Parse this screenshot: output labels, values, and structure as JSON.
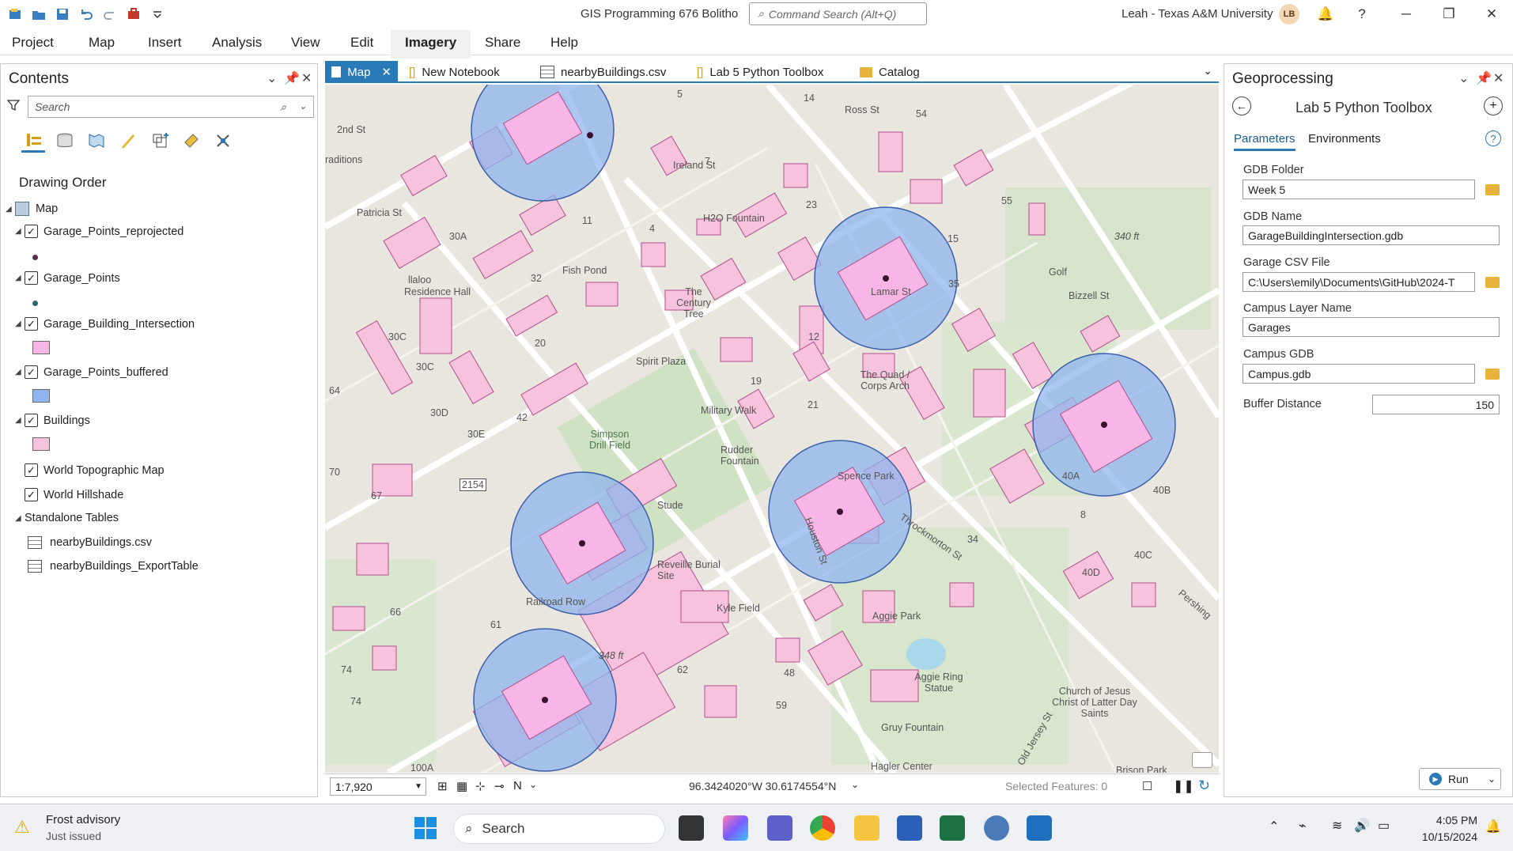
{
  "app": {
    "title": "GIS Programming 676 Bolitho",
    "command_search_placeholder": "Command Search (Alt+Q)",
    "user": "Leah - Texas A&M University",
    "avatar_initials": "LB"
  },
  "menu": [
    "Project",
    "Map",
    "Insert",
    "Analysis",
    "View",
    "Edit",
    "Imagery",
    "Share",
    "Help"
  ],
  "contents": {
    "title": "Contents",
    "search_placeholder": "Search",
    "drawing_order": "Drawing Order",
    "map_label": "Map",
    "layers": [
      {
        "name": "Garage_Points_reprojected",
        "symbol_color": "#5a2a4a"
      },
      {
        "name": "Garage_Points",
        "symbol_color": "#2c6a6a"
      },
      {
        "name": "Garage_Building_Intersection",
        "symbol_color": "#f7b6e6"
      },
      {
        "name": "Garage_Points_buffered",
        "symbol_color": "#8fb4ee"
      },
      {
        "name": "Buildings",
        "symbol_color": "#f7c2dc"
      },
      {
        "name": "World Topographic Map"
      },
      {
        "name": "World Hillshade"
      }
    ],
    "standalone_tables_label": "Standalone Tables",
    "tables": [
      "nearbyBuildings.csv",
      "nearbyBuildings_ExportTable"
    ]
  },
  "map_tabs": [
    "Map",
    "New Notebook",
    "nearbyBuildings.csv",
    "Lab 5 Python Toolbox",
    "Catalog"
  ],
  "map": {
    "labels": [
      "5",
      "14",
      "54",
      "Ross St",
      "raditions",
      "2nd St",
      "7",
      "Ireland St",
      "H2O Fountain",
      "23",
      "15",
      "55",
      "Patricia St",
      "30A",
      "11",
      "4",
      "340 ft",
      "Golf",
      "32",
      "Fish Pond",
      "llaloo",
      "Residence Hall",
      "The Century Tree",
      "Lamar St",
      "35",
      "Bizzell St",
      "30C",
      "20",
      "Spirit Plaza",
      "12",
      "30C",
      "The Quad / Corps Arch",
      "19",
      "64",
      "30D",
      "42",
      "Military Walk",
      "21",
      "Simpson Drill Field",
      "30E",
      "Rudder Fountain",
      "Spence Park",
      "40A",
      "40B",
      "70",
      "2154",
      "67",
      "Stude",
      "Houston St",
      "Throckmorton St",
      "8",
      "34",
      "40C",
      "Reveille Burial Site",
      "40D",
      "Railroad Row",
      "Kyle Field",
      "Aggie Park",
      "66",
      "Pershing",
      "61",
      "348 ft",
      "62",
      "48",
      "74",
      "Aggie Ring Statue",
      "74",
      "59",
      "Church of Jesus Christ of Latter Day Saints",
      "Gruy Fountain",
      "Old Jersey St",
      "100A",
      "Hagler Center",
      "Brison Park"
    ],
    "scale": "1:7,920",
    "coordinates": "96.3424020°W 30.6174554°N",
    "selected_features": "Selected Features: 0"
  },
  "geoprocessing": {
    "title": "Geoprocessing",
    "tool_title": "Lab 5 Python Toolbox",
    "tabs": [
      "Parameters",
      "Environments"
    ],
    "params": [
      {
        "label": "GDB Folder",
        "value": "Week 5"
      },
      {
        "label": "GDB Name",
        "value": "GarageBuildingIntersection.gdb"
      },
      {
        "label": "Garage CSV File",
        "value": "C:\\Users\\emily\\Documents\\GitHub\\2024-T"
      },
      {
        "label": "Campus Layer Name",
        "value": "Garages"
      },
      {
        "label": "Campus GDB",
        "value": "Campus.gdb"
      },
      {
        "label": "Buffer Distance",
        "value": "150"
      }
    ],
    "run_label": "Run"
  },
  "taskbar": {
    "weather_title": "Frost advisory",
    "weather_sub": "Just issued",
    "search_label": "Search",
    "time": "4:05 PM",
    "date": "10/15/2024"
  }
}
